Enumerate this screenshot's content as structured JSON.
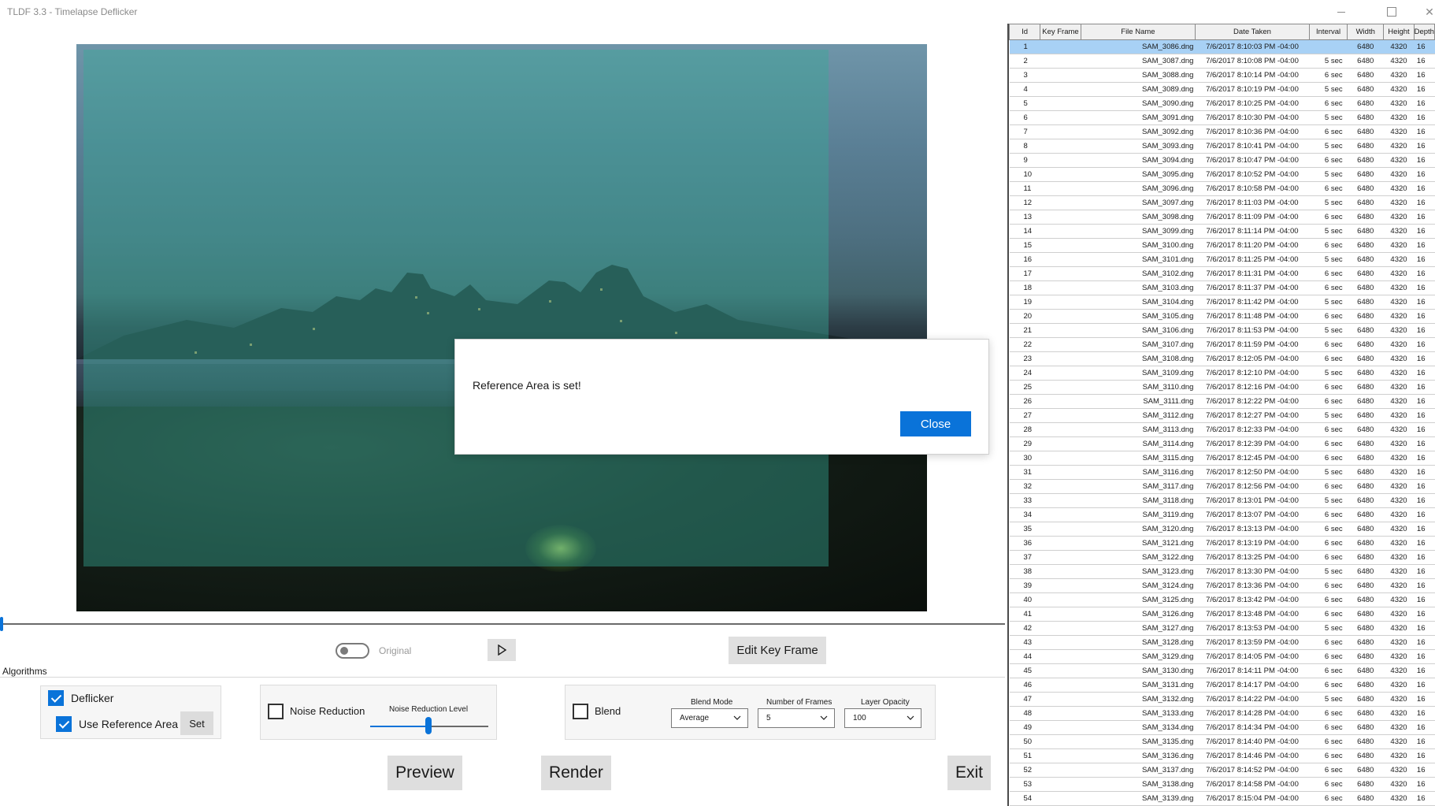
{
  "window": {
    "title": "TLDF 3.3 - Timelapse Deflicker",
    "close_glyph": "✕"
  },
  "dialog": {
    "message": "Reference Area is set!",
    "close_label": "Close"
  },
  "playback": {
    "original_label": "Original",
    "edit_key_frame_label": "Edit Key Frame"
  },
  "algorithms": {
    "section_label": "Algorithms",
    "deflicker_label": "Deflicker",
    "deflicker_checked": true,
    "use_reference_area_label": "Use Reference Area",
    "use_reference_area_checked": true,
    "set_label": "Set",
    "noise_reduction_label": "Noise Reduction",
    "noise_reduction_checked": false,
    "noise_reduction_level_label": "Noise Reduction Level",
    "noise_reduction_level_fraction": 0.49,
    "blend_label": "Blend",
    "blend_checked": false,
    "blend_mode_label": "Blend Mode",
    "blend_mode_value": "Average",
    "number_of_frames_label": "Number of Frames",
    "number_of_frames_value": "5",
    "layer_opacity_label": "Layer Opacity",
    "layer_opacity_value": "100"
  },
  "actions": {
    "preview_label": "Preview",
    "render_label": "Render",
    "exit_label": "Exit"
  },
  "colors": {
    "accent": "#0a73d9",
    "selected_row": "#a8d1f5",
    "reference_overlay": "#38aa96"
  },
  "table": {
    "columns": [
      "Id",
      "Key Frame",
      "File Name",
      "Date Taken",
      "Interval",
      "Width",
      "Height",
      "Depth"
    ],
    "selected_id": "1",
    "rows": [
      [
        "1",
        "",
        "SAM_3086.dng",
        "7/6/2017 8:10:03 PM -04:00",
        "",
        "6480",
        "4320",
        "16"
      ],
      [
        "2",
        "",
        "SAM_3087.dng",
        "7/6/2017 8:10:08 PM -04:00",
        "5 sec",
        "6480",
        "4320",
        "16"
      ],
      [
        "3",
        "",
        "SAM_3088.dng",
        "7/6/2017 8:10:14 PM -04:00",
        "6 sec",
        "6480",
        "4320",
        "16"
      ],
      [
        "4",
        "",
        "SAM_3089.dng",
        "7/6/2017 8:10:19 PM -04:00",
        "5 sec",
        "6480",
        "4320",
        "16"
      ],
      [
        "5",
        "",
        "SAM_3090.dng",
        "7/6/2017 8:10:25 PM -04:00",
        "6 sec",
        "6480",
        "4320",
        "16"
      ],
      [
        "6",
        "",
        "SAM_3091.dng",
        "7/6/2017 8:10:30 PM -04:00",
        "5 sec",
        "6480",
        "4320",
        "16"
      ],
      [
        "7",
        "",
        "SAM_3092.dng",
        "7/6/2017 8:10:36 PM -04:00",
        "6 sec",
        "6480",
        "4320",
        "16"
      ],
      [
        "8",
        "",
        "SAM_3093.dng",
        "7/6/2017 8:10:41 PM -04:00",
        "5 sec",
        "6480",
        "4320",
        "16"
      ],
      [
        "9",
        "",
        "SAM_3094.dng",
        "7/6/2017 8:10:47 PM -04:00",
        "6 sec",
        "6480",
        "4320",
        "16"
      ],
      [
        "10",
        "",
        "SAM_3095.dng",
        "7/6/2017 8:10:52 PM -04:00",
        "5 sec",
        "6480",
        "4320",
        "16"
      ],
      [
        "11",
        "",
        "SAM_3096.dng",
        "7/6/2017 8:10:58 PM -04:00",
        "6 sec",
        "6480",
        "4320",
        "16"
      ],
      [
        "12",
        "",
        "SAM_3097.dng",
        "7/6/2017 8:11:03 PM -04:00",
        "5 sec",
        "6480",
        "4320",
        "16"
      ],
      [
        "13",
        "",
        "SAM_3098.dng",
        "7/6/2017 8:11:09 PM -04:00",
        "6 sec",
        "6480",
        "4320",
        "16"
      ],
      [
        "14",
        "",
        "SAM_3099.dng",
        "7/6/2017 8:11:14 PM -04:00",
        "5 sec",
        "6480",
        "4320",
        "16"
      ],
      [
        "15",
        "",
        "SAM_3100.dng",
        "7/6/2017 8:11:20 PM -04:00",
        "6 sec",
        "6480",
        "4320",
        "16"
      ],
      [
        "16",
        "",
        "SAM_3101.dng",
        "7/6/2017 8:11:25 PM -04:00",
        "5 sec",
        "6480",
        "4320",
        "16"
      ],
      [
        "17",
        "",
        "SAM_3102.dng",
        "7/6/2017 8:11:31 PM -04:00",
        "6 sec",
        "6480",
        "4320",
        "16"
      ],
      [
        "18",
        "",
        "SAM_3103.dng",
        "7/6/2017 8:11:37 PM -04:00",
        "6 sec",
        "6480",
        "4320",
        "16"
      ],
      [
        "19",
        "",
        "SAM_3104.dng",
        "7/6/2017 8:11:42 PM -04:00",
        "5 sec",
        "6480",
        "4320",
        "16"
      ],
      [
        "20",
        "",
        "SAM_3105.dng",
        "7/6/2017 8:11:48 PM -04:00",
        "6 sec",
        "6480",
        "4320",
        "16"
      ],
      [
        "21",
        "",
        "SAM_3106.dng",
        "7/6/2017 8:11:53 PM -04:00",
        "5 sec",
        "6480",
        "4320",
        "16"
      ],
      [
        "22",
        "",
        "SAM_3107.dng",
        "7/6/2017 8:11:59 PM -04:00",
        "6 sec",
        "6480",
        "4320",
        "16"
      ],
      [
        "23",
        "",
        "SAM_3108.dng",
        "7/6/2017 8:12:05 PM -04:00",
        "6 sec",
        "6480",
        "4320",
        "16"
      ],
      [
        "24",
        "",
        "SAM_3109.dng",
        "7/6/2017 8:12:10 PM -04:00",
        "5 sec",
        "6480",
        "4320",
        "16"
      ],
      [
        "25",
        "",
        "SAM_3110.dng",
        "7/6/2017 8:12:16 PM -04:00",
        "6 sec",
        "6480",
        "4320",
        "16"
      ],
      [
        "26",
        "",
        "SAM_3111.dng",
        "7/6/2017 8:12:22 PM -04:00",
        "6 sec",
        "6480",
        "4320",
        "16"
      ],
      [
        "27",
        "",
        "SAM_3112.dng",
        "7/6/2017 8:12:27 PM -04:00",
        "5 sec",
        "6480",
        "4320",
        "16"
      ],
      [
        "28",
        "",
        "SAM_3113.dng",
        "7/6/2017 8:12:33 PM -04:00",
        "6 sec",
        "6480",
        "4320",
        "16"
      ],
      [
        "29",
        "",
        "SAM_3114.dng",
        "7/6/2017 8:12:39 PM -04:00",
        "6 sec",
        "6480",
        "4320",
        "16"
      ],
      [
        "30",
        "",
        "SAM_3115.dng",
        "7/6/2017 8:12:45 PM -04:00",
        "6 sec",
        "6480",
        "4320",
        "16"
      ],
      [
        "31",
        "",
        "SAM_3116.dng",
        "7/6/2017 8:12:50 PM -04:00",
        "5 sec",
        "6480",
        "4320",
        "16"
      ],
      [
        "32",
        "",
        "SAM_3117.dng",
        "7/6/2017 8:12:56 PM -04:00",
        "6 sec",
        "6480",
        "4320",
        "16"
      ],
      [
        "33",
        "",
        "SAM_3118.dng",
        "7/6/2017 8:13:01 PM -04:00",
        "5 sec",
        "6480",
        "4320",
        "16"
      ],
      [
        "34",
        "",
        "SAM_3119.dng",
        "7/6/2017 8:13:07 PM -04:00",
        "6 sec",
        "6480",
        "4320",
        "16"
      ],
      [
        "35",
        "",
        "SAM_3120.dng",
        "7/6/2017 8:13:13 PM -04:00",
        "6 sec",
        "6480",
        "4320",
        "16"
      ],
      [
        "36",
        "",
        "SAM_3121.dng",
        "7/6/2017 8:13:19 PM -04:00",
        "6 sec",
        "6480",
        "4320",
        "16"
      ],
      [
        "37",
        "",
        "SAM_3122.dng",
        "7/6/2017 8:13:25 PM -04:00",
        "6 sec",
        "6480",
        "4320",
        "16"
      ],
      [
        "38",
        "",
        "SAM_3123.dng",
        "7/6/2017 8:13:30 PM -04:00",
        "5 sec",
        "6480",
        "4320",
        "16"
      ],
      [
        "39",
        "",
        "SAM_3124.dng",
        "7/6/2017 8:13:36 PM -04:00",
        "6 sec",
        "6480",
        "4320",
        "16"
      ],
      [
        "40",
        "",
        "SAM_3125.dng",
        "7/6/2017 8:13:42 PM -04:00",
        "6 sec",
        "6480",
        "4320",
        "16"
      ],
      [
        "41",
        "",
        "SAM_3126.dng",
        "7/6/2017 8:13:48 PM -04:00",
        "6 sec",
        "6480",
        "4320",
        "16"
      ],
      [
        "42",
        "",
        "SAM_3127.dng",
        "7/6/2017 8:13:53 PM -04:00",
        "5 sec",
        "6480",
        "4320",
        "16"
      ],
      [
        "43",
        "",
        "SAM_3128.dng",
        "7/6/2017 8:13:59 PM -04:00",
        "6 sec",
        "6480",
        "4320",
        "16"
      ],
      [
        "44",
        "",
        "SAM_3129.dng",
        "7/6/2017 8:14:05 PM -04:00",
        "6 sec",
        "6480",
        "4320",
        "16"
      ],
      [
        "45",
        "",
        "SAM_3130.dng",
        "7/6/2017 8:14:11 PM -04:00",
        "6 sec",
        "6480",
        "4320",
        "16"
      ],
      [
        "46",
        "",
        "SAM_3131.dng",
        "7/6/2017 8:14:17 PM -04:00",
        "6 sec",
        "6480",
        "4320",
        "16"
      ],
      [
        "47",
        "",
        "SAM_3132.dng",
        "7/6/2017 8:14:22 PM -04:00",
        "5 sec",
        "6480",
        "4320",
        "16"
      ],
      [
        "48",
        "",
        "SAM_3133.dng",
        "7/6/2017 8:14:28 PM -04:00",
        "6 sec",
        "6480",
        "4320",
        "16"
      ],
      [
        "49",
        "",
        "SAM_3134.dng",
        "7/6/2017 8:14:34 PM -04:00",
        "6 sec",
        "6480",
        "4320",
        "16"
      ],
      [
        "50",
        "",
        "SAM_3135.dng",
        "7/6/2017 8:14:40 PM -04:00",
        "6 sec",
        "6480",
        "4320",
        "16"
      ],
      [
        "51",
        "",
        "SAM_3136.dng",
        "7/6/2017 8:14:46 PM -04:00",
        "6 sec",
        "6480",
        "4320",
        "16"
      ],
      [
        "52",
        "",
        "SAM_3137.dng",
        "7/6/2017 8:14:52 PM -04:00",
        "6 sec",
        "6480",
        "4320",
        "16"
      ],
      [
        "53",
        "",
        "SAM_3138.dng",
        "7/6/2017 8:14:58 PM -04:00",
        "6 sec",
        "6480",
        "4320",
        "16"
      ],
      [
        "54",
        "",
        "SAM_3139.dng",
        "7/6/2017 8:15:04 PM -04:00",
        "6 sec",
        "6480",
        "4320",
        "16"
      ]
    ]
  }
}
